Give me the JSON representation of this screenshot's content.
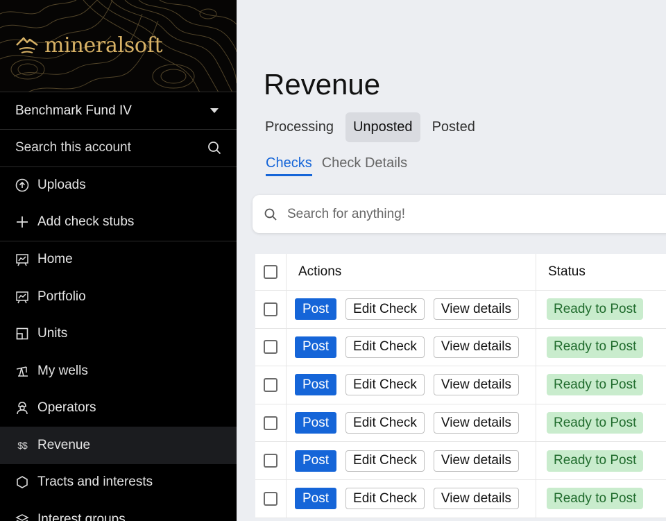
{
  "brand": {
    "name": "mineralsoft",
    "accent": "#d8b266"
  },
  "sidebar": {
    "account": "Benchmark Fund IV",
    "search_label": "Search this account",
    "items": [
      {
        "label": "Uploads",
        "icon": "upload-icon"
      },
      {
        "label": "Add check stubs",
        "icon": "plus-icon"
      },
      {
        "label": "Home",
        "icon": "chart-board-icon"
      },
      {
        "label": "Portfolio",
        "icon": "chart-board-icon"
      },
      {
        "label": "Units",
        "icon": "units-icon"
      },
      {
        "label": "My wells",
        "icon": "pump-jack-icon"
      },
      {
        "label": "Operators",
        "icon": "worker-icon"
      },
      {
        "label": "Revenue",
        "icon": "dollar-icon",
        "icon_text": "$$",
        "active": true
      },
      {
        "label": "Tracts and interests",
        "icon": "hexagon-icon"
      },
      {
        "label": "Interest groups",
        "icon": "layers-icon"
      }
    ]
  },
  "main": {
    "title": "Revenue",
    "tabs": [
      {
        "label": "Processing"
      },
      {
        "label": "Unposted",
        "active": true
      },
      {
        "label": "Posted"
      }
    ],
    "subtabs": [
      {
        "label": "Checks",
        "active": true
      },
      {
        "label": "Check Details"
      }
    ],
    "search": {
      "placeholder": "Search for anything!"
    }
  },
  "table": {
    "headers": {
      "actions": "Actions",
      "status": "Status"
    },
    "rows": [
      {
        "post": "Post",
        "edit": "Edit Check",
        "view": "View details",
        "status": "Ready to Post"
      },
      {
        "post": "Post",
        "edit": "Edit Check",
        "view": "View details",
        "status": "Ready to Post"
      },
      {
        "post": "Post",
        "edit": "Edit Check",
        "view": "View details",
        "status": "Ready to Post"
      },
      {
        "post": "Post",
        "edit": "Edit Check",
        "view": "View details",
        "status": "Ready to Post"
      },
      {
        "post": "Post",
        "edit": "Edit Check",
        "view": "View details",
        "status": "Ready to Post"
      },
      {
        "post": "Post",
        "edit": "Edit Check",
        "view": "View details",
        "status": "Ready to Post"
      }
    ]
  },
  "colors": {
    "primary": "#1565d8",
    "status_bg": "#c9eccd",
    "status_text": "#1f6b2c",
    "sidebar_bg": "#000000"
  }
}
